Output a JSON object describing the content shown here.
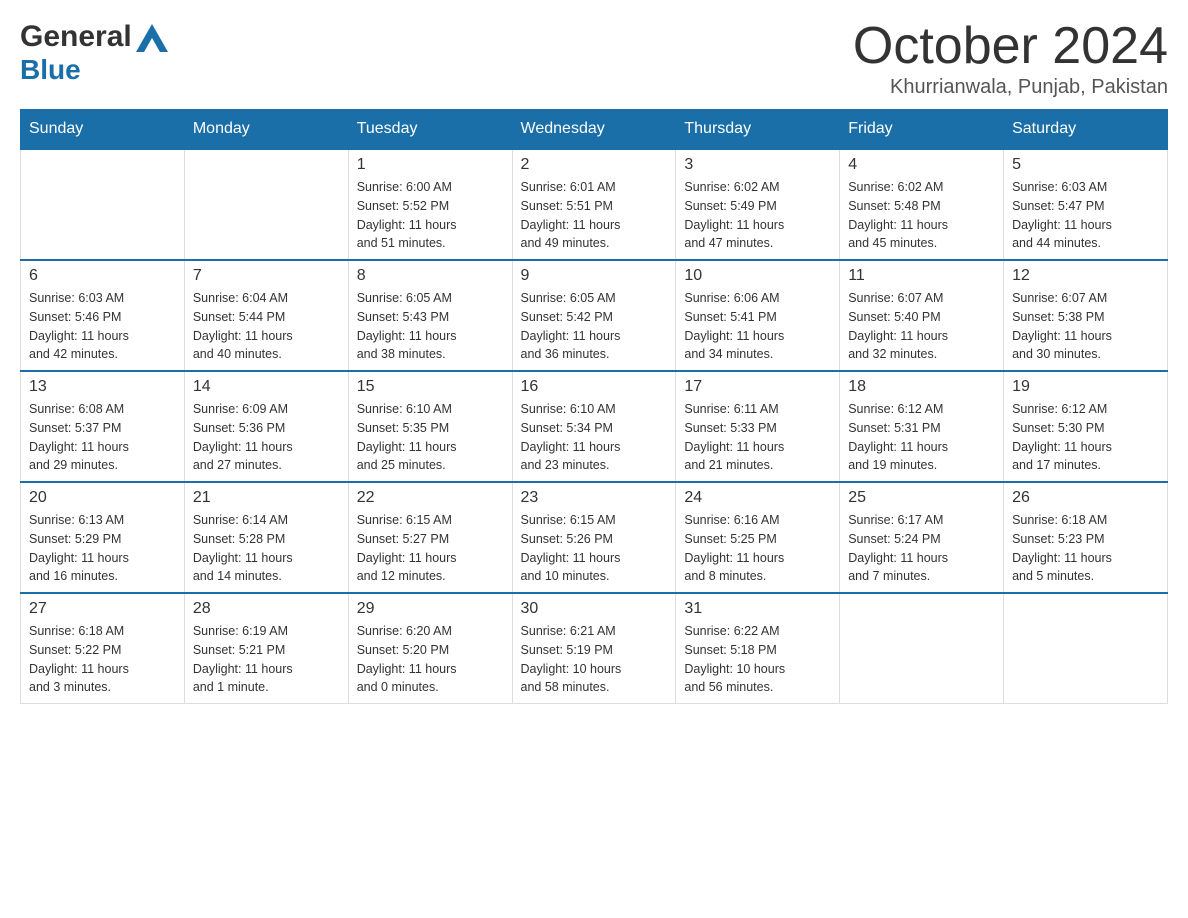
{
  "header": {
    "logo_general": "General",
    "logo_blue": "Blue",
    "month_title": "October 2024",
    "location": "Khurrianwala, Punjab, Pakistan"
  },
  "calendar": {
    "days_of_week": [
      "Sunday",
      "Monday",
      "Tuesday",
      "Wednesday",
      "Thursday",
      "Friday",
      "Saturday"
    ],
    "weeks": [
      [
        {
          "day": "",
          "info": ""
        },
        {
          "day": "",
          "info": ""
        },
        {
          "day": "1",
          "info": "Sunrise: 6:00 AM\nSunset: 5:52 PM\nDaylight: 11 hours\nand 51 minutes."
        },
        {
          "day": "2",
          "info": "Sunrise: 6:01 AM\nSunset: 5:51 PM\nDaylight: 11 hours\nand 49 minutes."
        },
        {
          "day": "3",
          "info": "Sunrise: 6:02 AM\nSunset: 5:49 PM\nDaylight: 11 hours\nand 47 minutes."
        },
        {
          "day": "4",
          "info": "Sunrise: 6:02 AM\nSunset: 5:48 PM\nDaylight: 11 hours\nand 45 minutes."
        },
        {
          "day": "5",
          "info": "Sunrise: 6:03 AM\nSunset: 5:47 PM\nDaylight: 11 hours\nand 44 minutes."
        }
      ],
      [
        {
          "day": "6",
          "info": "Sunrise: 6:03 AM\nSunset: 5:46 PM\nDaylight: 11 hours\nand 42 minutes."
        },
        {
          "day": "7",
          "info": "Sunrise: 6:04 AM\nSunset: 5:44 PM\nDaylight: 11 hours\nand 40 minutes."
        },
        {
          "day": "8",
          "info": "Sunrise: 6:05 AM\nSunset: 5:43 PM\nDaylight: 11 hours\nand 38 minutes."
        },
        {
          "day": "9",
          "info": "Sunrise: 6:05 AM\nSunset: 5:42 PM\nDaylight: 11 hours\nand 36 minutes."
        },
        {
          "day": "10",
          "info": "Sunrise: 6:06 AM\nSunset: 5:41 PM\nDaylight: 11 hours\nand 34 minutes."
        },
        {
          "day": "11",
          "info": "Sunrise: 6:07 AM\nSunset: 5:40 PM\nDaylight: 11 hours\nand 32 minutes."
        },
        {
          "day": "12",
          "info": "Sunrise: 6:07 AM\nSunset: 5:38 PM\nDaylight: 11 hours\nand 30 minutes."
        }
      ],
      [
        {
          "day": "13",
          "info": "Sunrise: 6:08 AM\nSunset: 5:37 PM\nDaylight: 11 hours\nand 29 minutes."
        },
        {
          "day": "14",
          "info": "Sunrise: 6:09 AM\nSunset: 5:36 PM\nDaylight: 11 hours\nand 27 minutes."
        },
        {
          "day": "15",
          "info": "Sunrise: 6:10 AM\nSunset: 5:35 PM\nDaylight: 11 hours\nand 25 minutes."
        },
        {
          "day": "16",
          "info": "Sunrise: 6:10 AM\nSunset: 5:34 PM\nDaylight: 11 hours\nand 23 minutes."
        },
        {
          "day": "17",
          "info": "Sunrise: 6:11 AM\nSunset: 5:33 PM\nDaylight: 11 hours\nand 21 minutes."
        },
        {
          "day": "18",
          "info": "Sunrise: 6:12 AM\nSunset: 5:31 PM\nDaylight: 11 hours\nand 19 minutes."
        },
        {
          "day": "19",
          "info": "Sunrise: 6:12 AM\nSunset: 5:30 PM\nDaylight: 11 hours\nand 17 minutes."
        }
      ],
      [
        {
          "day": "20",
          "info": "Sunrise: 6:13 AM\nSunset: 5:29 PM\nDaylight: 11 hours\nand 16 minutes."
        },
        {
          "day": "21",
          "info": "Sunrise: 6:14 AM\nSunset: 5:28 PM\nDaylight: 11 hours\nand 14 minutes."
        },
        {
          "day": "22",
          "info": "Sunrise: 6:15 AM\nSunset: 5:27 PM\nDaylight: 11 hours\nand 12 minutes."
        },
        {
          "day": "23",
          "info": "Sunrise: 6:15 AM\nSunset: 5:26 PM\nDaylight: 11 hours\nand 10 minutes."
        },
        {
          "day": "24",
          "info": "Sunrise: 6:16 AM\nSunset: 5:25 PM\nDaylight: 11 hours\nand 8 minutes."
        },
        {
          "day": "25",
          "info": "Sunrise: 6:17 AM\nSunset: 5:24 PM\nDaylight: 11 hours\nand 7 minutes."
        },
        {
          "day": "26",
          "info": "Sunrise: 6:18 AM\nSunset: 5:23 PM\nDaylight: 11 hours\nand 5 minutes."
        }
      ],
      [
        {
          "day": "27",
          "info": "Sunrise: 6:18 AM\nSunset: 5:22 PM\nDaylight: 11 hours\nand 3 minutes."
        },
        {
          "day": "28",
          "info": "Sunrise: 6:19 AM\nSunset: 5:21 PM\nDaylight: 11 hours\nand 1 minute."
        },
        {
          "day": "29",
          "info": "Sunrise: 6:20 AM\nSunset: 5:20 PM\nDaylight: 11 hours\nand 0 minutes."
        },
        {
          "day": "30",
          "info": "Sunrise: 6:21 AM\nSunset: 5:19 PM\nDaylight: 10 hours\nand 58 minutes."
        },
        {
          "day": "31",
          "info": "Sunrise: 6:22 AM\nSunset: 5:18 PM\nDaylight: 10 hours\nand 56 minutes."
        },
        {
          "day": "",
          "info": ""
        },
        {
          "day": "",
          "info": ""
        }
      ]
    ]
  }
}
